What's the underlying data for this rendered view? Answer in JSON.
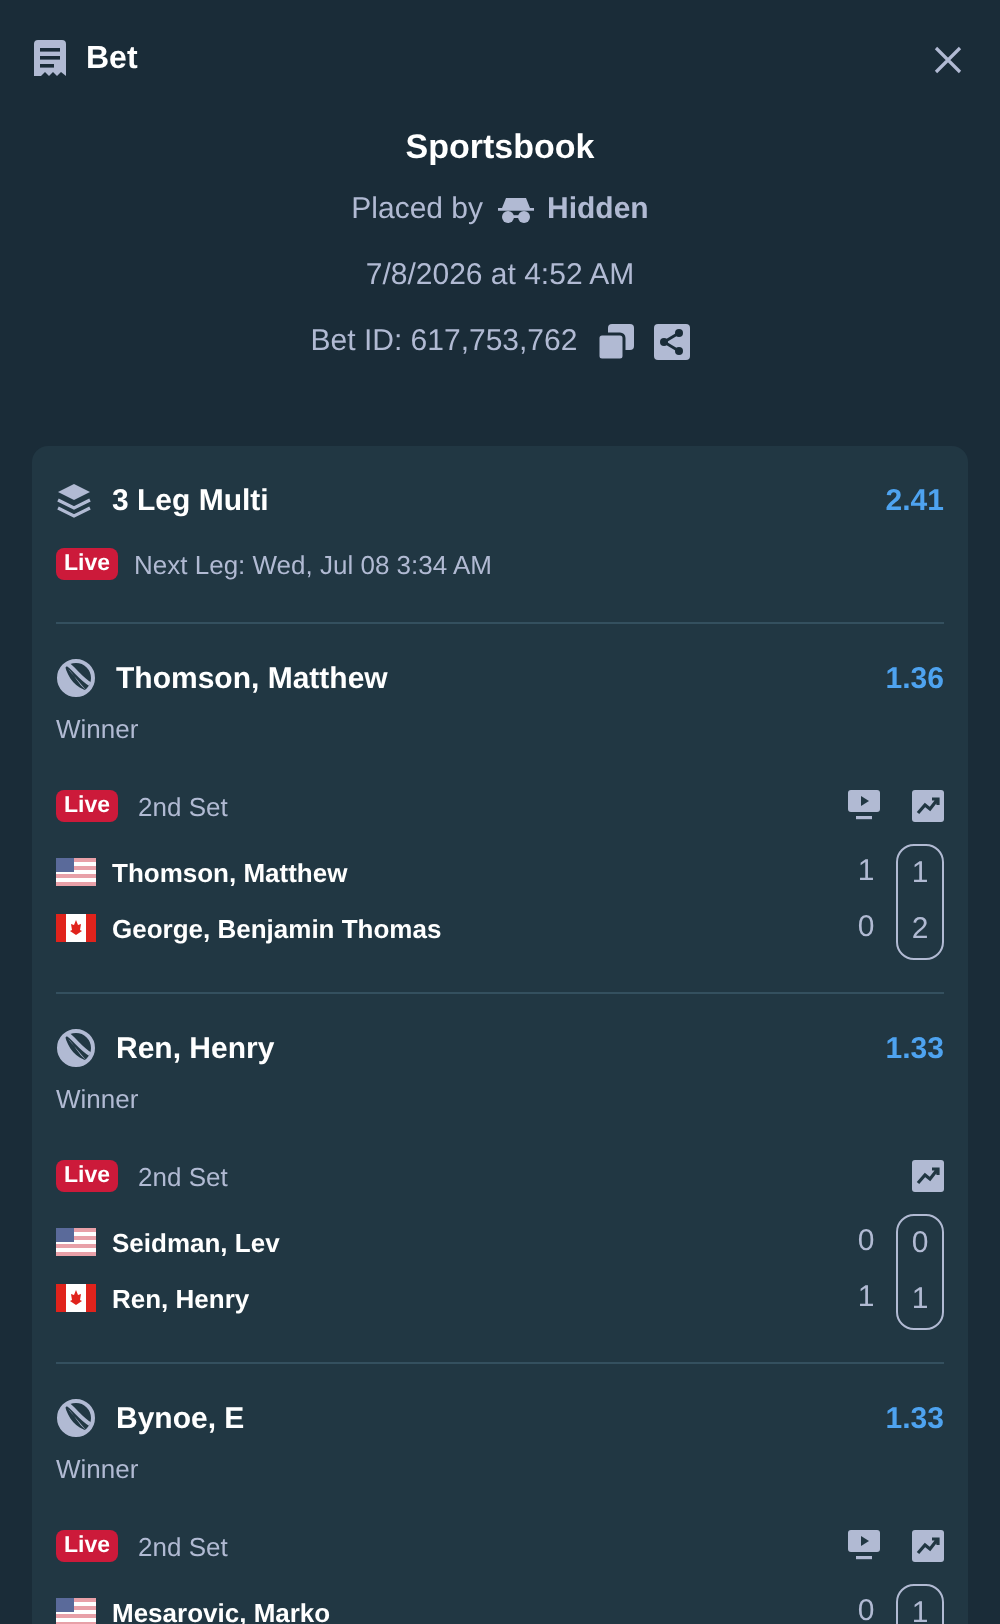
{
  "header": {
    "title": "Bet"
  },
  "summary": {
    "provider": "Sportsbook",
    "placed_by_label": "Placed by",
    "placed_by": "Hidden",
    "placed_at": "7/8/2026 at 4:52 AM",
    "bet_id": "Bet ID: 617,753,762"
  },
  "multi": {
    "title": "3 Leg Multi",
    "odds": "2.41",
    "live": true,
    "live_label": "Live",
    "next_leg": "Next Leg: Wed, Jul 08 3:34 AM"
  },
  "legs": [
    {
      "selection": "Thomson, Matthew",
      "odds": "1.36",
      "market": "Winner",
      "live": true,
      "live_label": "Live",
      "period": "2nd Set",
      "stream": true,
      "stats": true,
      "players": [
        {
          "kind": "usa",
          "name": "Thomson, Matthew",
          "game": "1",
          "set": "1"
        },
        {
          "kind": "canada",
          "name": "George, Benjamin Thomas",
          "game": "0",
          "set": "2"
        }
      ]
    },
    {
      "selection": "Ren, Henry",
      "odds": "1.33",
      "market": "Winner",
      "live": true,
      "live_label": "Live",
      "period": "2nd Set",
      "stream": false,
      "stats": true,
      "players": [
        {
          "kind": "usa",
          "name": "Seidman, Lev",
          "game": "0",
          "set": "0"
        },
        {
          "kind": "canada",
          "name": "Ren, Henry",
          "game": "1",
          "set": "1"
        }
      ]
    },
    {
      "selection": "Bynoe, E",
      "odds": "1.33",
      "market": "Winner",
      "live": true,
      "live_label": "Live",
      "period": "2nd Set",
      "stream": true,
      "stats": true,
      "players": [
        {
          "kind": "usa",
          "name": "Mesarovic, Marko",
          "game": "0",
          "set": "1"
        }
      ]
    }
  ]
}
